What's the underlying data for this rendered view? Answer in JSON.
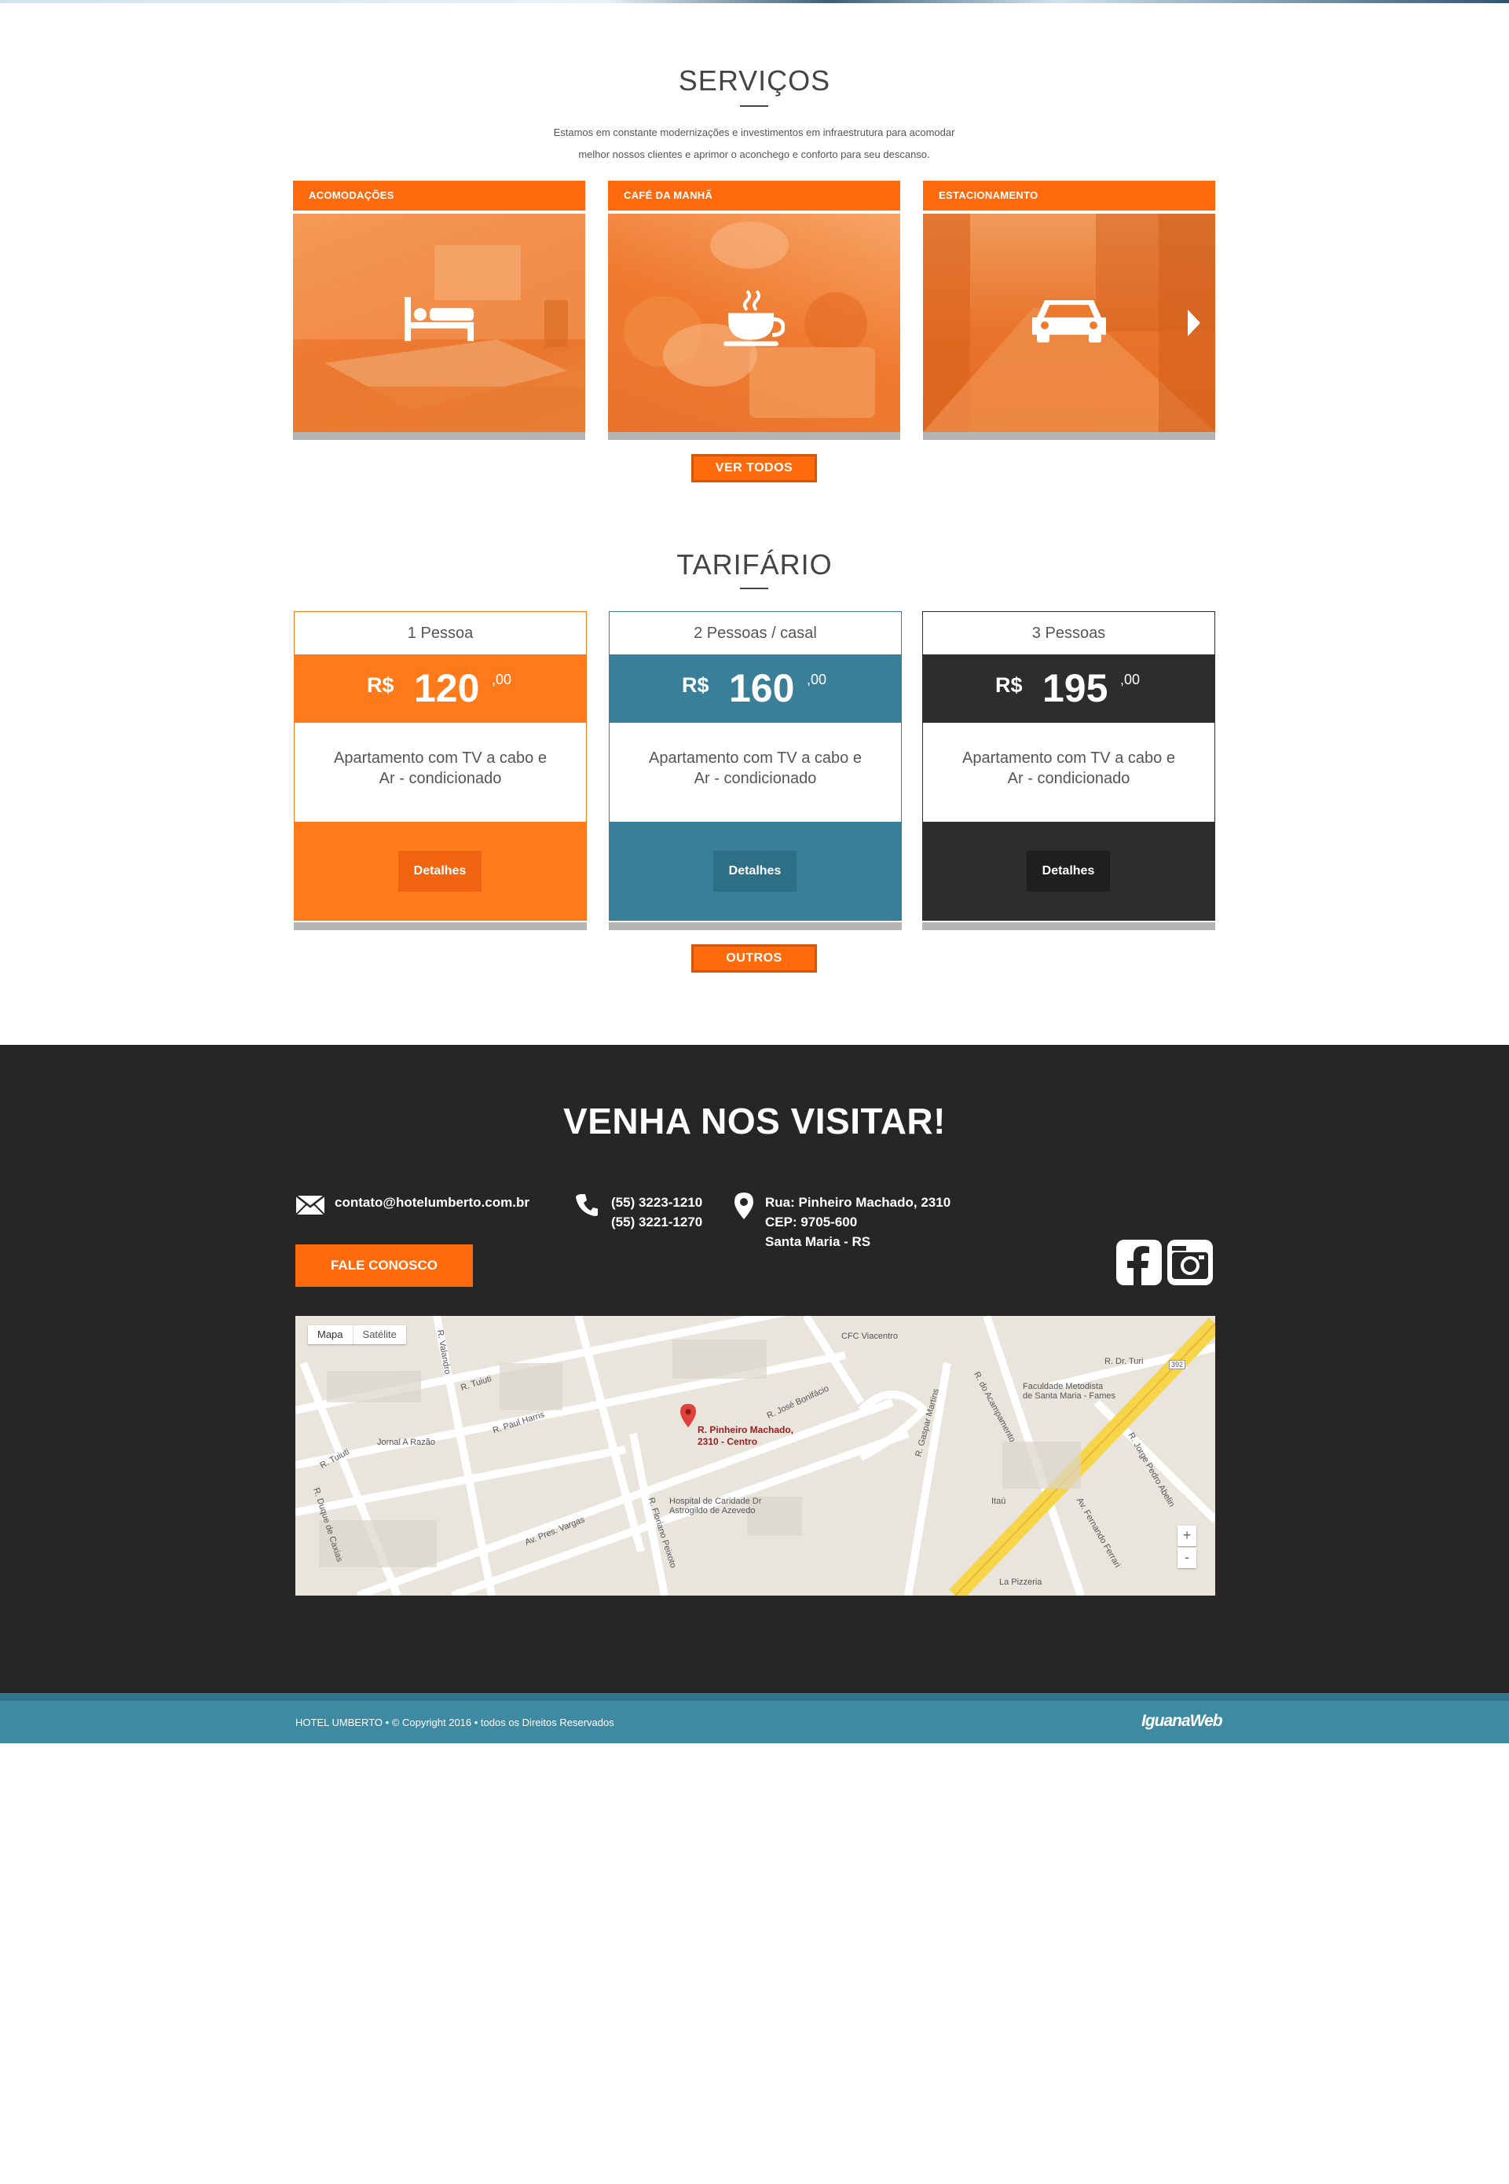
{
  "services": {
    "title": "SERVIÇOS",
    "intro_line1": "Estamos em constante modernizações e investimentos em infraestrutura para acomodar",
    "intro_line2": "melhor nossos clientes e aprimor o aconchego e conforto para seu descanso.",
    "cards": [
      {
        "label": "ACOMODAÇÕES",
        "icon": "bed-icon"
      },
      {
        "label": "CAFÉ DA MANHÃ",
        "icon": "coffee-cup-icon"
      },
      {
        "label": "ESTACIONAMENTO",
        "icon": "car-icon"
      }
    ],
    "view_all_label": "VER TODOS",
    "accent_color": "#ff6a0d"
  },
  "pricing": {
    "title": "TARIFÁRIO",
    "plans": [
      {
        "name": "1 Pessoa",
        "currency": "R$",
        "amount": "120",
        "cents": ",00",
        "desc1": "Apartamento com TV a cabo e",
        "desc2": "Ar - condicionado",
        "button": "Detalhes",
        "color": "#ff7a1a"
      },
      {
        "name": "2 Pessoas / casal",
        "currency": "R$",
        "amount": "160",
        "cents": ",00",
        "desc1": "Apartamento com TV a cabo e",
        "desc2": "Ar - condicionado",
        "button": "Detalhes",
        "color": "#3a7f99"
      },
      {
        "name": "3 Pessoas",
        "currency": "R$",
        "amount": "195",
        "cents": ",00",
        "desc1": "Apartamento com TV a cabo e",
        "desc2": "Ar - condicionado",
        "button": "Detalhes",
        "color": "#2d2d2d"
      }
    ],
    "others_label": "OUTROS"
  },
  "visit": {
    "title": "VENHA NOS VISITAR!",
    "email": "contato@hotelumberto.com.br",
    "phone1": "(55) 3223-1210",
    "phone2": "(55) 3221-1270",
    "address1": "Rua: Pinheiro Machado, 2310",
    "address2": "CEP: 9705-600",
    "address3": "Santa Maria - RS",
    "contact_button": "FALE CONOSCO",
    "social": [
      "facebook-icon",
      "instagram-icon"
    ]
  },
  "map": {
    "tab_map": "Mapa",
    "tab_satellite": "Satélite",
    "pin_label1": "R. Pinheiro Machado,",
    "pin_label2": "2310 - Centro",
    "labels": {
      "cfc": "CFC Viacentro",
      "faculdade1": "Faculdade Metodista",
      "faculdade2": "de Santa Maria - Fames",
      "jornal": "Jornal A Razão",
      "hospital1": "Hospital de Caridade Dr",
      "hospital2": "Astrogildo de Azevedo",
      "itau": "Itaú",
      "pizzeria": "La Pizzeria",
      "jose_bonifacio": "R. José Bonifácio",
      "tuiuti1": "R. Tuiuti",
      "tuiuti2": "R. Tuiuti",
      "paul_harris": "R. Paul Harris",
      "pres_vargas": "Av. Pres. Vargas",
      "floriano": "R. Floriano Peixoto",
      "duque": "R. Duque de Caxias",
      "acampamento": "R. do Acampamento",
      "gaspar": "R. Gaspar Martins",
      "fernando": "Av. Fernando Ferrari",
      "jorge": "R. Jorge Pedro Abelin",
      "dr_turi": "R. Dr. Turi",
      "vale": "R. Valandro",
      "route": "392"
    },
    "zoom_in": "+",
    "zoom_out": "-"
  },
  "footer": {
    "copyright": "HOTEL UMBERTO • © Copyright 2016 • todos os Direitos Reservados",
    "brand": "IguanaWeb"
  }
}
